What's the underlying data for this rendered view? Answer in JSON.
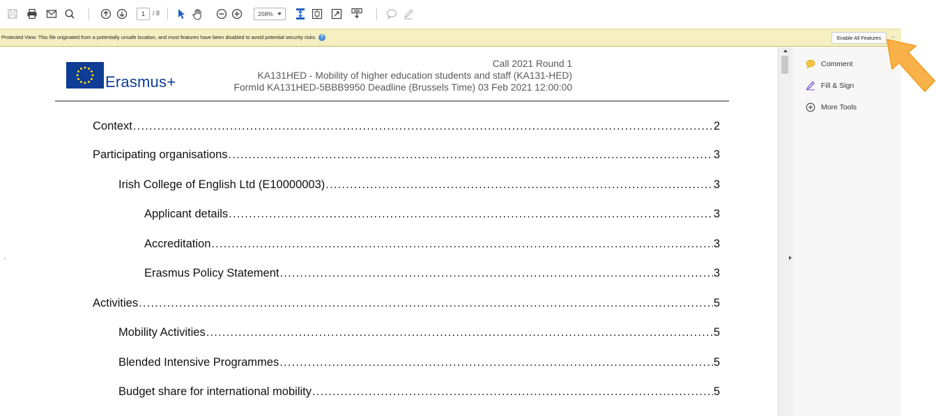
{
  "toolbar": {
    "page_current": "1",
    "page_total": "/ 8",
    "zoom": "208%"
  },
  "protected_view": {
    "message": "Protected View: This file originated from a potentially unsafe location, and most features have been disabled to avoid potential security risks.",
    "enable_button": "Enable All Features",
    "close": "×"
  },
  "document": {
    "logo_text": "Erasmus+",
    "header_line1": "Call 2021 Round 1",
    "header_line2": "KA131HED - Mobility of higher education students and staff (KA131-HED)",
    "header_line3": "FormId KA131HED-5BBB9950 Deadline (Brussels Time) 03 Feb 2021 12:00:00",
    "toc": [
      {
        "label": "Context",
        "page": "2",
        "level": 0
      },
      {
        "label": "Participating organisations",
        "page": "3",
        "level": 0
      },
      {
        "label": "Irish College of English Ltd (E10000003)",
        "page": "3",
        "level": 1
      },
      {
        "label": "Applicant details",
        "page": "3",
        "level": 2
      },
      {
        "label": "Accreditation",
        "page": "3",
        "level": 2
      },
      {
        "label": "Erasmus Policy Statement",
        "page": "3",
        "level": 2
      },
      {
        "label": "Activities",
        "page": "5",
        "level": 0
      },
      {
        "label": "Mobility Activities",
        "page": "5",
        "level": 1
      },
      {
        "label": "Blended Intensive Programmes",
        "page": "5",
        "level": 1
      },
      {
        "label": "Budget share for international mobility",
        "page": "5",
        "level": 1
      }
    ]
  },
  "tools_pane": {
    "items": [
      {
        "label": "Comment",
        "icon": "comment-icon"
      },
      {
        "label": "Fill & Sign",
        "icon": "fill-sign-icon"
      },
      {
        "label": "More Tools",
        "icon": "add-circle-icon"
      }
    ]
  },
  "colors": {
    "protected_bar": "#f5efc2",
    "erasmus_blue": "#0b3c94",
    "callout_orange": "#f9b24a"
  }
}
